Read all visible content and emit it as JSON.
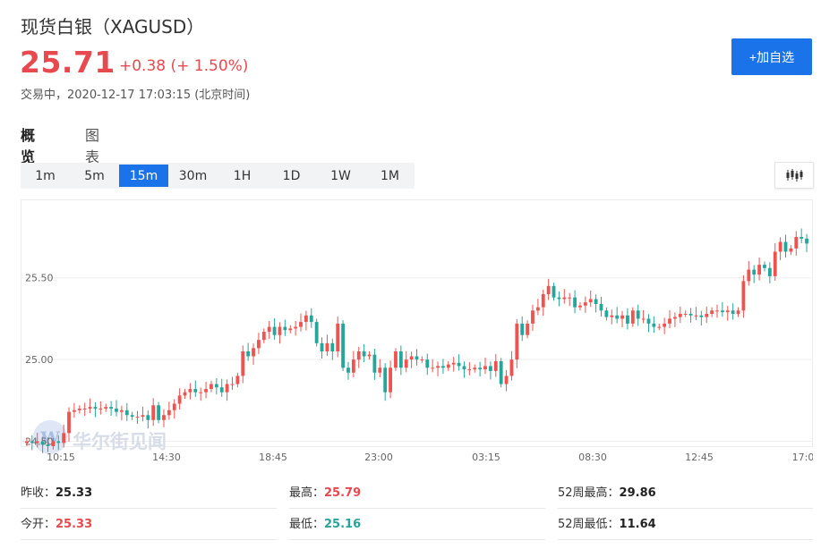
{
  "header": {
    "title": "现货白银（XAGUSD）",
    "price": "25.71",
    "change": "+0.38 (+ 1.50%)",
    "status": "交易中，",
    "timestamp": "2020-12-17 17:03:15 (北京时间)",
    "add_watchlist_label": "+加自选"
  },
  "tabs": [
    {
      "label": "概览",
      "active": true
    },
    {
      "label": "图表",
      "active": false
    }
  ],
  "intervals": [
    {
      "label": "1m"
    },
    {
      "label": "5m"
    },
    {
      "label": "15m",
      "active": true
    },
    {
      "label": "30m"
    },
    {
      "label": "1H"
    },
    {
      "label": "1D"
    },
    {
      "label": "1W"
    },
    {
      "label": "1M"
    }
  ],
  "chart_type_icon": "candlestick-icon",
  "watermark": "华尔街见闻",
  "colors": {
    "up": "#ef5350",
    "down": "#26a69a",
    "accent": "#1a73e8"
  },
  "chart_data": {
    "type": "candlestick",
    "x_ticks": [
      "10:15",
      "14:30",
      "18:45",
      "23:00",
      "03:15",
      "08:30",
      "12:45",
      "17:0"
    ],
    "y_ticks": [
      "25.50",
      "25.00",
      "24.50"
    ],
    "ylim": [
      24.47,
      25.98
    ],
    "closes": [
      24.5,
      24.49,
      24.5,
      24.48,
      24.47,
      24.5,
      24.49,
      24.55,
      24.68,
      24.69,
      24.7,
      24.7,
      24.71,
      24.7,
      24.7,
      24.71,
      24.7,
      24.68,
      24.69,
      24.66,
      24.65,
      24.65,
      24.66,
      24.63,
      24.72,
      24.63,
      24.66,
      24.69,
      24.73,
      24.78,
      24.8,
      24.82,
      24.8,
      24.8,
      24.82,
      24.85,
      24.83,
      24.8,
      24.85,
      24.85,
      24.9,
      25.05,
      25.02,
      25.07,
      25.12,
      25.17,
      25.2,
      25.15,
      25.2,
      25.18,
      25.19,
      25.2,
      25.23,
      25.27,
      25.23,
      25.1,
      25.05,
      25.1,
      25.05,
      25.22,
      24.95,
      24.92,
      25.0,
      25.05,
      25.02,
      25.03,
      24.92,
      24.95,
      24.8,
      24.95,
      25.05,
      24.95,
      25.0,
      25.02,
      25.0,
      25.0,
      24.95,
      24.95,
      24.96,
      24.95,
      24.97,
      24.98,
      24.96,
      24.94,
      24.94,
      24.95,
      24.94,
      24.96,
      24.93,
      24.99,
      24.85,
      24.9,
      25.0,
      25.22,
      25.15,
      25.22,
      25.3,
      25.32,
      25.4,
      25.45,
      25.38,
      25.37,
      25.38,
      25.38,
      25.32,
      25.33,
      25.35,
      25.37,
      25.34,
      25.3,
      25.26,
      25.27,
      25.25,
      25.27,
      25.22,
      25.3,
      25.25,
      25.25,
      25.22,
      25.2,
      25.2,
      25.22,
      25.25,
      25.26,
      25.28,
      25.28,
      25.27,
      25.27,
      25.26,
      25.28,
      25.3,
      25.3,
      25.29,
      25.3,
      25.28,
      25.3,
      25.48,
      25.55,
      25.52,
      25.58,
      25.56,
      25.51,
      25.66,
      25.72,
      25.66,
      25.68,
      25.75,
      25.74,
      25.71
    ],
    "opens": [
      24.49,
      24.5,
      24.49,
      24.5,
      24.48,
      24.47,
      24.5,
      24.49,
      24.55,
      24.68,
      24.69,
      24.7,
      24.7,
      24.71,
      24.7,
      24.7,
      24.71,
      24.7,
      24.68,
      24.69,
      24.66,
      24.65,
      24.65,
      24.66,
      24.63,
      24.72,
      24.63,
      24.66,
      24.69,
      24.73,
      24.78,
      24.8,
      24.82,
      24.8,
      24.8,
      24.82,
      24.85,
      24.83,
      24.8,
      24.85,
      24.85,
      24.9,
      25.05,
      25.02,
      25.07,
      25.12,
      25.17,
      25.2,
      25.15,
      25.2,
      25.18,
      25.19,
      25.2,
      25.23,
      25.27,
      25.23,
      25.1,
      25.05,
      25.1,
      25.05,
      25.22,
      24.95,
      24.92,
      25.0,
      25.05,
      25.02,
      25.03,
      24.92,
      24.95,
      24.8,
      24.95,
      25.05,
      24.95,
      25.0,
      25.02,
      25.0,
      25.0,
      24.95,
      24.95,
      24.96,
      24.95,
      24.97,
      24.98,
      24.96,
      24.94,
      24.94,
      24.95,
      24.94,
      24.96,
      24.93,
      24.99,
      24.85,
      24.9,
      25.0,
      25.22,
      25.15,
      25.22,
      25.3,
      25.32,
      25.4,
      25.45,
      25.38,
      25.37,
      25.38,
      25.38,
      25.32,
      25.33,
      25.35,
      25.37,
      25.34,
      25.3,
      25.26,
      25.27,
      25.25,
      25.27,
      25.22,
      25.3,
      25.25,
      25.25,
      25.22,
      25.2,
      25.2,
      25.22,
      25.25,
      25.26,
      25.28,
      25.28,
      25.27,
      25.27,
      25.26,
      25.28,
      25.3,
      25.3,
      25.29,
      25.3,
      25.28,
      25.3,
      25.48,
      25.55,
      25.52,
      25.58,
      25.56,
      25.51,
      25.66,
      25.72,
      25.66,
      25.68,
      25.75,
      25.74
    ]
  },
  "stats": {
    "prev_close_label": "昨收：",
    "prev_close": "25.33",
    "high_label": "最高：",
    "high": "25.79",
    "week52_high_label": "52周最高：",
    "week52_high": "29.86",
    "open_label": "今开：",
    "open": "25.33",
    "low_label": "最低：",
    "low": "25.16",
    "week52_low_label": "52周最低：",
    "week52_low": "11.64"
  }
}
